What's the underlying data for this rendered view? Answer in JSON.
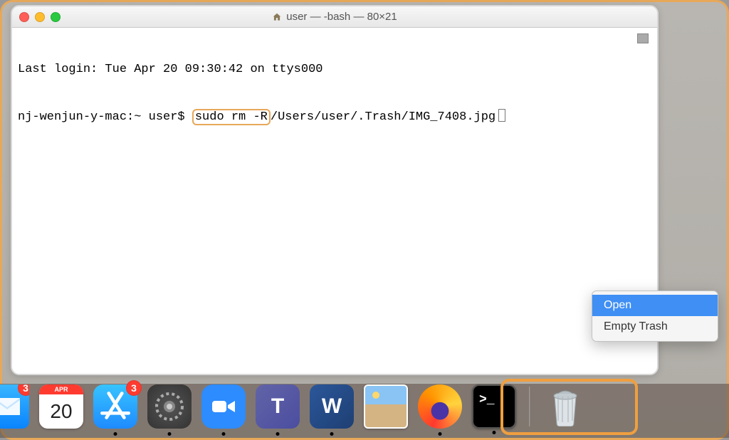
{
  "window": {
    "title": "user — -bash — 80×21"
  },
  "terminal": {
    "line1": "Last login: Tue Apr 20 09:30:42 on ttys000",
    "prompt": "nj-wenjun-y-mac:~ user$ ",
    "cmd_highlighted": "sudo rm -R",
    "cmd_rest": "/Users/user/.Trash/IMG_7408.jpg"
  },
  "context_menu": {
    "open": "Open",
    "empty": "Empty Trash"
  },
  "dock": {
    "mail_badge": "3",
    "cal_month": "APR",
    "cal_day": "20",
    "store_badge": "3",
    "teams_letter": "T",
    "word_letter": "W",
    "term_prompt": ">_"
  }
}
